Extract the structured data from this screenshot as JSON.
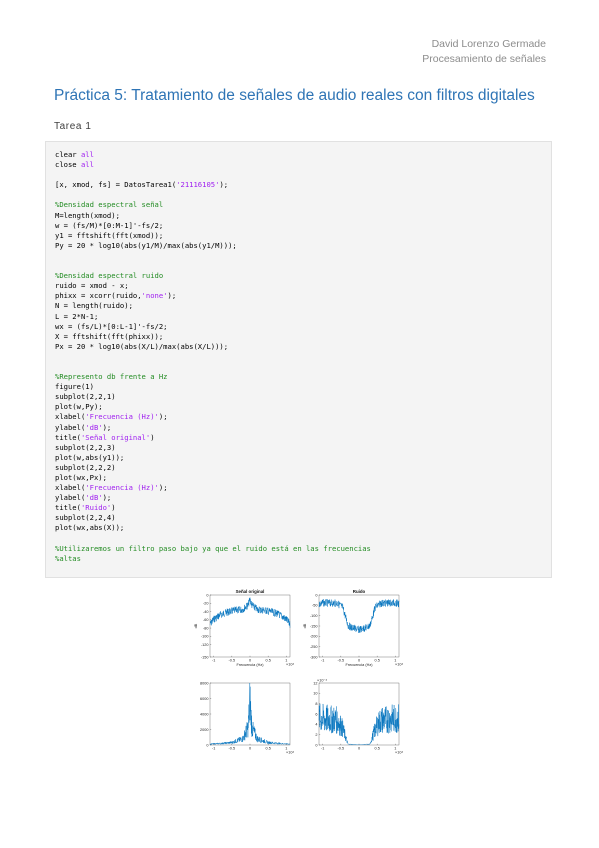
{
  "header": {
    "author": "David Lorenzo Germade",
    "course": "Procesamiento de señales"
  },
  "document": {
    "title": "Práctica 5: Tratamiento de señales de audio reales con filtros digitales",
    "subtitle": "Tarea 1"
  },
  "code_lines": [
    [
      [
        "k",
        "clear "
      ],
      [
        "s",
        "all"
      ]
    ],
    [
      [
        "k",
        "close "
      ],
      [
        "s",
        "all"
      ]
    ],
    [
      [
        "k",
        ""
      ]
    ],
    [
      [
        "k",
        "[x, xmod, fs] = DatosTarea1("
      ],
      [
        "s",
        "'21116105'"
      ],
      [
        "k",
        ");"
      ]
    ],
    [
      [
        "k",
        ""
      ]
    ],
    [
      [
        "c",
        "%Densidad espectral señal"
      ]
    ],
    [
      [
        "k",
        "M=length(xmod);"
      ]
    ],
    [
      [
        "k",
        "w = (fs/M)*[0:M-1]'-fs/2;"
      ]
    ],
    [
      [
        "k",
        "y1 = fftshift(fft(xmod));"
      ]
    ],
    [
      [
        "k",
        "Py = 20 * log10(abs(y1/M)/max(abs(y1/M)));"
      ]
    ],
    [
      [
        "k",
        ""
      ]
    ],
    [
      [
        "k",
        ""
      ]
    ],
    [
      [
        "c",
        "%Densidad espectral ruido"
      ]
    ],
    [
      [
        "k",
        "ruido = xmod - x;"
      ]
    ],
    [
      [
        "k",
        "phixx = xcorr(ruido,"
      ],
      [
        "s",
        "'none'"
      ],
      [
        "k",
        ");"
      ]
    ],
    [
      [
        "k",
        "N = length(ruido);"
      ]
    ],
    [
      [
        "k",
        "L = 2*N-1;"
      ]
    ],
    [
      [
        "k",
        "wx = (fs/L)*[0:L-1]'-fs/2;"
      ]
    ],
    [
      [
        "k",
        "X = fftshift(fft(phixx));"
      ]
    ],
    [
      [
        "k",
        "Px = 20 * log10(abs(X/L)/max(abs(X/L)));"
      ]
    ],
    [
      [
        "k",
        ""
      ]
    ],
    [
      [
        "k",
        ""
      ]
    ],
    [
      [
        "c",
        "%Represento db frente a Hz"
      ]
    ],
    [
      [
        "k",
        "figure(1)"
      ]
    ],
    [
      [
        "k",
        "subplot(2,2,1)"
      ]
    ],
    [
      [
        "k",
        "plot(w,Py);"
      ]
    ],
    [
      [
        "k",
        "xlabel("
      ],
      [
        "s",
        "'Frecuencia (Hz)'"
      ],
      [
        "k",
        ");"
      ]
    ],
    [
      [
        "k",
        "ylabel("
      ],
      [
        "s",
        "'dB'"
      ],
      [
        "k",
        ");"
      ]
    ],
    [
      [
        "k",
        "title("
      ],
      [
        "s",
        "'Señal original'"
      ],
      [
        "k",
        ")"
      ]
    ],
    [
      [
        "k",
        "subplot(2,2,3)"
      ]
    ],
    [
      [
        "k",
        "plot(w,abs(y1));"
      ]
    ],
    [
      [
        "k",
        "subplot(2,2,2)"
      ]
    ],
    [
      [
        "k",
        "plot(wx,Px);"
      ]
    ],
    [
      [
        "k",
        "xlabel("
      ],
      [
        "s",
        "'Frecuencia (Hz)'"
      ],
      [
        "k",
        ");"
      ]
    ],
    [
      [
        "k",
        "ylabel("
      ],
      [
        "s",
        "'dB'"
      ],
      [
        "k",
        ");"
      ]
    ],
    [
      [
        "k",
        "title("
      ],
      [
        "s",
        "'Ruido'"
      ],
      [
        "k",
        ")"
      ]
    ],
    [
      [
        "k",
        "subplot(2,2,4)"
      ]
    ],
    [
      [
        "k",
        "plot(wx,abs(X));"
      ]
    ],
    [
      [
        "k",
        ""
      ]
    ],
    [
      [
        "c",
        "%Utilizaremos un filtro paso bajo ya que el ruido está en las frecuencias"
      ]
    ],
    [
      [
        "c",
        "%altas"
      ]
    ]
  ],
  "colors": {
    "plot_line": "#0072bd",
    "title": "#2e74b5",
    "comment": "#228b22",
    "string": "#a020f0"
  },
  "chart_data": [
    {
      "type": "line",
      "title": "Señal original",
      "xlabel": "Frecuencia (Hz)",
      "ylabel": "dB",
      "ylim": [
        -150,
        0
      ],
      "yticks": [
        "0",
        "-20",
        "-40",
        "-60",
        "-80",
        "-100",
        "-120",
        "-150"
      ],
      "xticks": [
        "-1",
        "-0.5",
        "0",
        "0.5",
        "1"
      ],
      "xexp": "×10⁴",
      "series": [
        {
          "x": [
            -1.1,
            -1,
            -0.8,
            -0.6,
            -0.4,
            -0.2,
            -0.05,
            0,
            0.05,
            0.2,
            0.4,
            0.6,
            0.8,
            1,
            1.1
          ],
          "values": [
            -62,
            -50,
            -38,
            -32,
            -28,
            -26,
            -15,
            -2,
            -15,
            -26,
            -28,
            -32,
            -38,
            -50,
            -62
          ]
        }
      ]
    },
    {
      "type": "line",
      "title": "Ruido",
      "xlabel": "Frecuencia (Hz)",
      "ylabel": "dB",
      "ylim": [
        -300,
        0
      ],
      "yticks": [
        "0",
        "-50",
        "-100",
        "-150",
        "-200",
        "-250",
        "-300"
      ],
      "xticks": [
        "-1",
        "-0.5",
        "0",
        "0.5",
        "1"
      ],
      "xexp": "×10⁴",
      "series": [
        {
          "x": [
            -1.1,
            -1,
            -0.6,
            -0.45,
            -0.3,
            -0.2,
            0,
            0.2,
            0.3,
            0.45,
            0.6,
            1,
            1.1
          ],
          "values": [
            -25,
            -20,
            -22,
            -40,
            -130,
            -140,
            -150,
            -140,
            -130,
            -40,
            -22,
            -20,
            -25
          ]
        }
      ]
    },
    {
      "type": "line",
      "title": "",
      "xlabel": "",
      "ylabel": "",
      "ylim": [
        0,
        8000
      ],
      "yticks": [
        "8000",
        "6000",
        "4000",
        "2000",
        "0"
      ],
      "xticks": [
        "-1",
        "-0.5",
        "0",
        "0.5",
        "1"
      ],
      "xexp": "×10⁴",
      "series": [
        {
          "x": [
            -1.1,
            -0.8,
            -0.5,
            -0.2,
            -0.05,
            0,
            0.05,
            0.2,
            0.5,
            0.8,
            1.1
          ],
          "values": [
            150,
            250,
            400,
            1000,
            2800,
            7500,
            2800,
            1000,
            400,
            250,
            150
          ]
        }
      ]
    },
    {
      "type": "line",
      "title": "",
      "xlabel": "",
      "ylabel": "",
      "ylim": [
        0,
        12
      ],
      "yticks": [
        "12",
        "10",
        "8",
        "6",
        "4",
        "2",
        "0"
      ],
      "yexp": "×10⁻⁴",
      "xticks": [
        "-1",
        "-0.5",
        "0",
        "0.5",
        "1"
      ],
      "xexp": "×10⁴",
      "series": [
        {
          "x": [
            -1.1,
            -0.6,
            -0.45,
            -0.3,
            0,
            0.3,
            0.45,
            0.6,
            1.1
          ],
          "values": [
            6.5,
            6,
            4,
            0.2,
            0.05,
            0.2,
            4,
            6,
            6.5
          ]
        }
      ]
    }
  ]
}
